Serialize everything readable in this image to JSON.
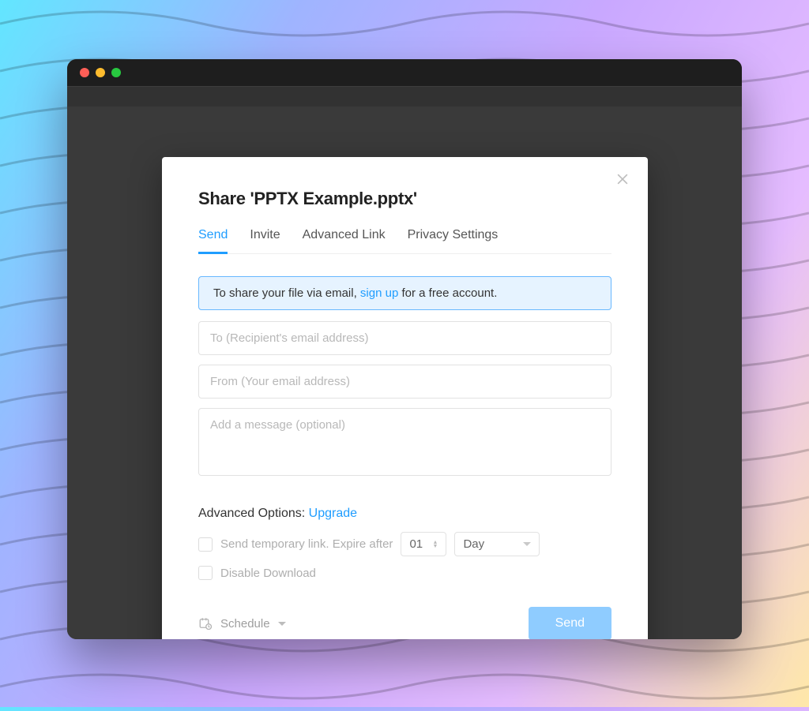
{
  "modal": {
    "title": "Share 'PPTX Example.pptx'",
    "tabs": [
      "Send",
      "Invite",
      "Advanced Link",
      "Privacy Settings"
    ],
    "active_tab_index": 0,
    "banner": {
      "prefix": "To share your file via email, ",
      "link": "sign up",
      "suffix": " for a free account."
    },
    "fields": {
      "to_placeholder": "To (Recipient's email address)",
      "from_placeholder": "From (Your email address)",
      "message_placeholder": "Add a message (optional)"
    },
    "advanced": {
      "label_prefix": "Advanced Options: ",
      "upgrade_link": "Upgrade",
      "temp_link_label": "Send temporary link. Expire after",
      "expiry_value": "01",
      "expiry_unit": "Day",
      "disable_download_label": "Disable Download"
    },
    "footer": {
      "schedule_label": "Schedule",
      "send_button": "Send"
    }
  }
}
